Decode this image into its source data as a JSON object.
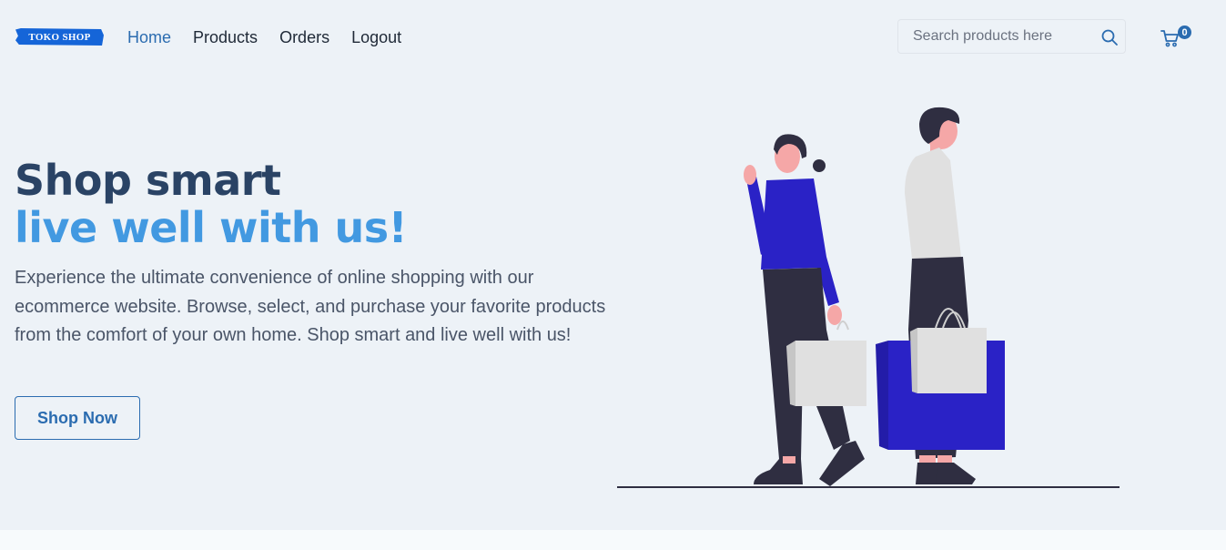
{
  "brand": {
    "logo_text": "TOKO SHOP"
  },
  "nav": {
    "links": [
      {
        "label": "Home",
        "active": true
      },
      {
        "label": "Products",
        "active": false
      },
      {
        "label": "Orders",
        "active": false
      },
      {
        "label": "Logout",
        "active": false
      }
    ]
  },
  "search": {
    "placeholder": "Search products here",
    "value": ""
  },
  "cart": {
    "count": "0"
  },
  "hero": {
    "title_line1": "Shop smart",
    "title_line2": "live well with us!",
    "description": "Experience the ultimate convenience of online shopping with our ecommerce website. Browse, select, and purchase your favorite products from the comfort of your own home. Shop smart and live well with us!",
    "cta_label": "Shop Now"
  },
  "colors": {
    "background": "#edf2f7",
    "primary": "#2b6cb0",
    "heading_dark": "#2a4365",
    "heading_light": "#4299e1",
    "logo_blue": "#1565d8",
    "illustration_blue": "#2a22c6"
  },
  "icons": {
    "search": "search-icon",
    "cart": "cart-icon",
    "illustration": "shoppers-illustration"
  }
}
